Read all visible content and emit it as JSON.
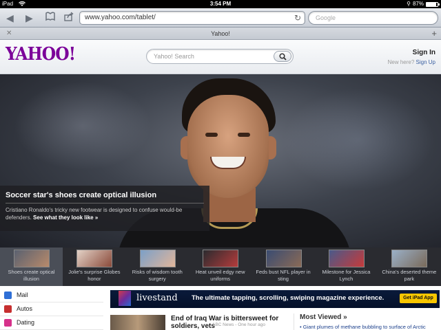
{
  "statusbar": {
    "carrier": "iPad",
    "time": "3:54 PM",
    "battery_text": "87%",
    "battery_level": 0.87
  },
  "browser": {
    "url": "www.yahoo.com/tablet/",
    "search_placeholder": "Google",
    "tab_title": "Yahoo!"
  },
  "header": {
    "logo": "YAHOO!",
    "search_placeholder": "Yahoo! Search",
    "sign_in": "Sign In",
    "new_here": "New here?",
    "sign_up": "Sign Up"
  },
  "hero": {
    "headline": "Soccer star's shoes create optical illusion",
    "description": "Cristiano Ronaldo's tricky new footwear is designed to confuse would-be defenders.",
    "link": "See what they look like »"
  },
  "thumbnails": [
    {
      "caption": "Shoes create optical illusion",
      "color1": "#5a6170",
      "color2": "#b88a6b",
      "active": true
    },
    {
      "caption": "Jolie's surprise Globes honor",
      "color1": "#e3d2c7",
      "color2": "#8a4a3a",
      "active": false
    },
    {
      "caption": "Risks of wisdom tooth surgery",
      "color1": "#7ca0c8",
      "color2": "#e1b59a",
      "active": false
    },
    {
      "caption": "Heat unveil edgy new uniforms",
      "color1": "#2b2b2f",
      "color2": "#b53c3c",
      "active": false
    },
    {
      "caption": "Feds bust NFL player in sting",
      "color1": "#3a4c72",
      "color2": "#8a6a56",
      "active": false
    },
    {
      "caption": "Milestone for Jessica Lynch",
      "color1": "#4a5a8a",
      "color2": "#c63a3a",
      "active": false
    },
    {
      "caption": "China's deserted theme park",
      "color1": "#9ab0c8",
      "color2": "#7a6a5a",
      "active": false
    }
  ],
  "sidenav": [
    {
      "label": "Mail",
      "color": "#2f6fd6"
    },
    {
      "label": "Autos",
      "color": "#c62f2f"
    },
    {
      "label": "Dating",
      "color": "#d6318a"
    }
  ],
  "ad": {
    "brand": "livestand",
    "tagline": "The ultimate tapping, scrolling, swiping magazine experience.",
    "button": "Get iPad App"
  },
  "news": {
    "headline": "End of Iraq War is bittersweet for soldiers, vets",
    "source": "ABC News - One hour ago"
  },
  "most_viewed": {
    "title": "Most Viewed »",
    "item": "Giant plumes of methane bubbling to surface of Arctic"
  }
}
